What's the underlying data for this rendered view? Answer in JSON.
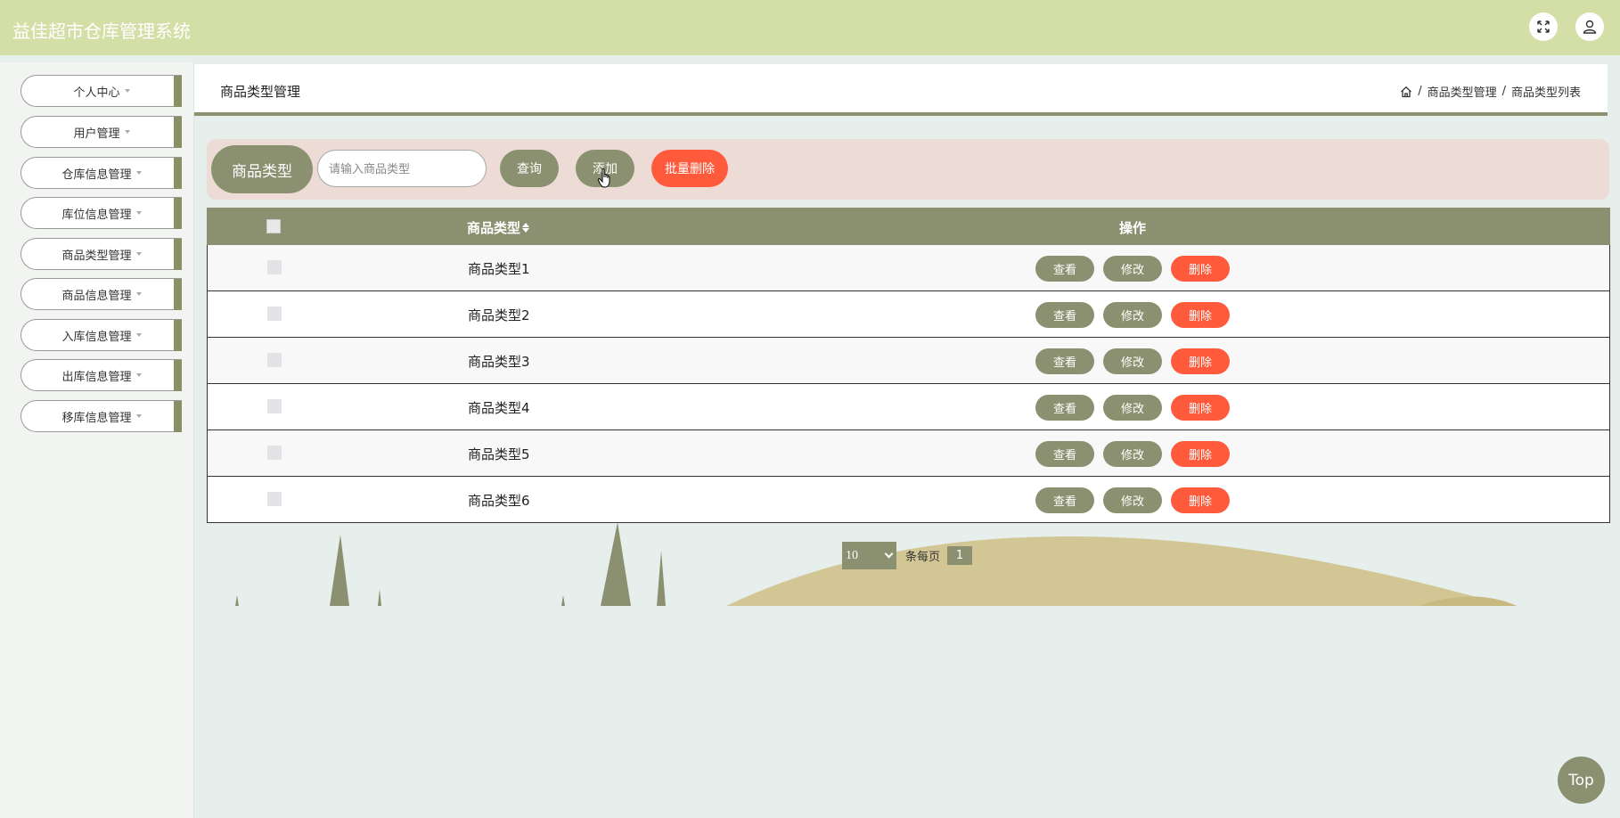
{
  "header": {
    "app_title": "益佳超市仓库管理系统",
    "icons": [
      "fullscreen-icon",
      "user-icon"
    ]
  },
  "sidebar": {
    "items": [
      {
        "label": "个人中心"
      },
      {
        "label": "用户管理"
      },
      {
        "label": "仓库信息管理"
      },
      {
        "label": "库位信息管理"
      },
      {
        "label": "商品类型管理"
      },
      {
        "label": "商品信息管理"
      },
      {
        "label": "入库信息管理"
      },
      {
        "label": "出库信息管理"
      },
      {
        "label": "移库信息管理"
      }
    ]
  },
  "page": {
    "title": "商品类型管理",
    "breadcrumb": [
      "商品类型管理",
      "商品类型列表"
    ],
    "breadcrumb_sep": "/"
  },
  "search": {
    "label": "商品类型",
    "placeholder": "请输入商品类型",
    "value": "",
    "query_button": "查询",
    "add_button": "添加",
    "batch_delete_button": "批量删除"
  },
  "table": {
    "columns": [
      "商品类型",
      "操作"
    ],
    "rows": [
      {
        "name": "商品类型1"
      },
      {
        "name": "商品类型2"
      },
      {
        "name": "商品类型3"
      },
      {
        "name": "商品类型4"
      },
      {
        "name": "商品类型5"
      },
      {
        "name": "商品类型6"
      }
    ],
    "actions": {
      "view": "查看",
      "edit": "修改",
      "delete": "删除"
    }
  },
  "pagination": {
    "page_size": "10",
    "per_page_label": "条每页",
    "current_page": "1"
  },
  "top_button": "Top",
  "colors": {
    "header_bg": "#d4dfa7",
    "primary": "#8b9170",
    "danger": "#ff5a3c",
    "search_panel_bg": "#ecdcd5",
    "page_bg": "#e6efeb"
  }
}
